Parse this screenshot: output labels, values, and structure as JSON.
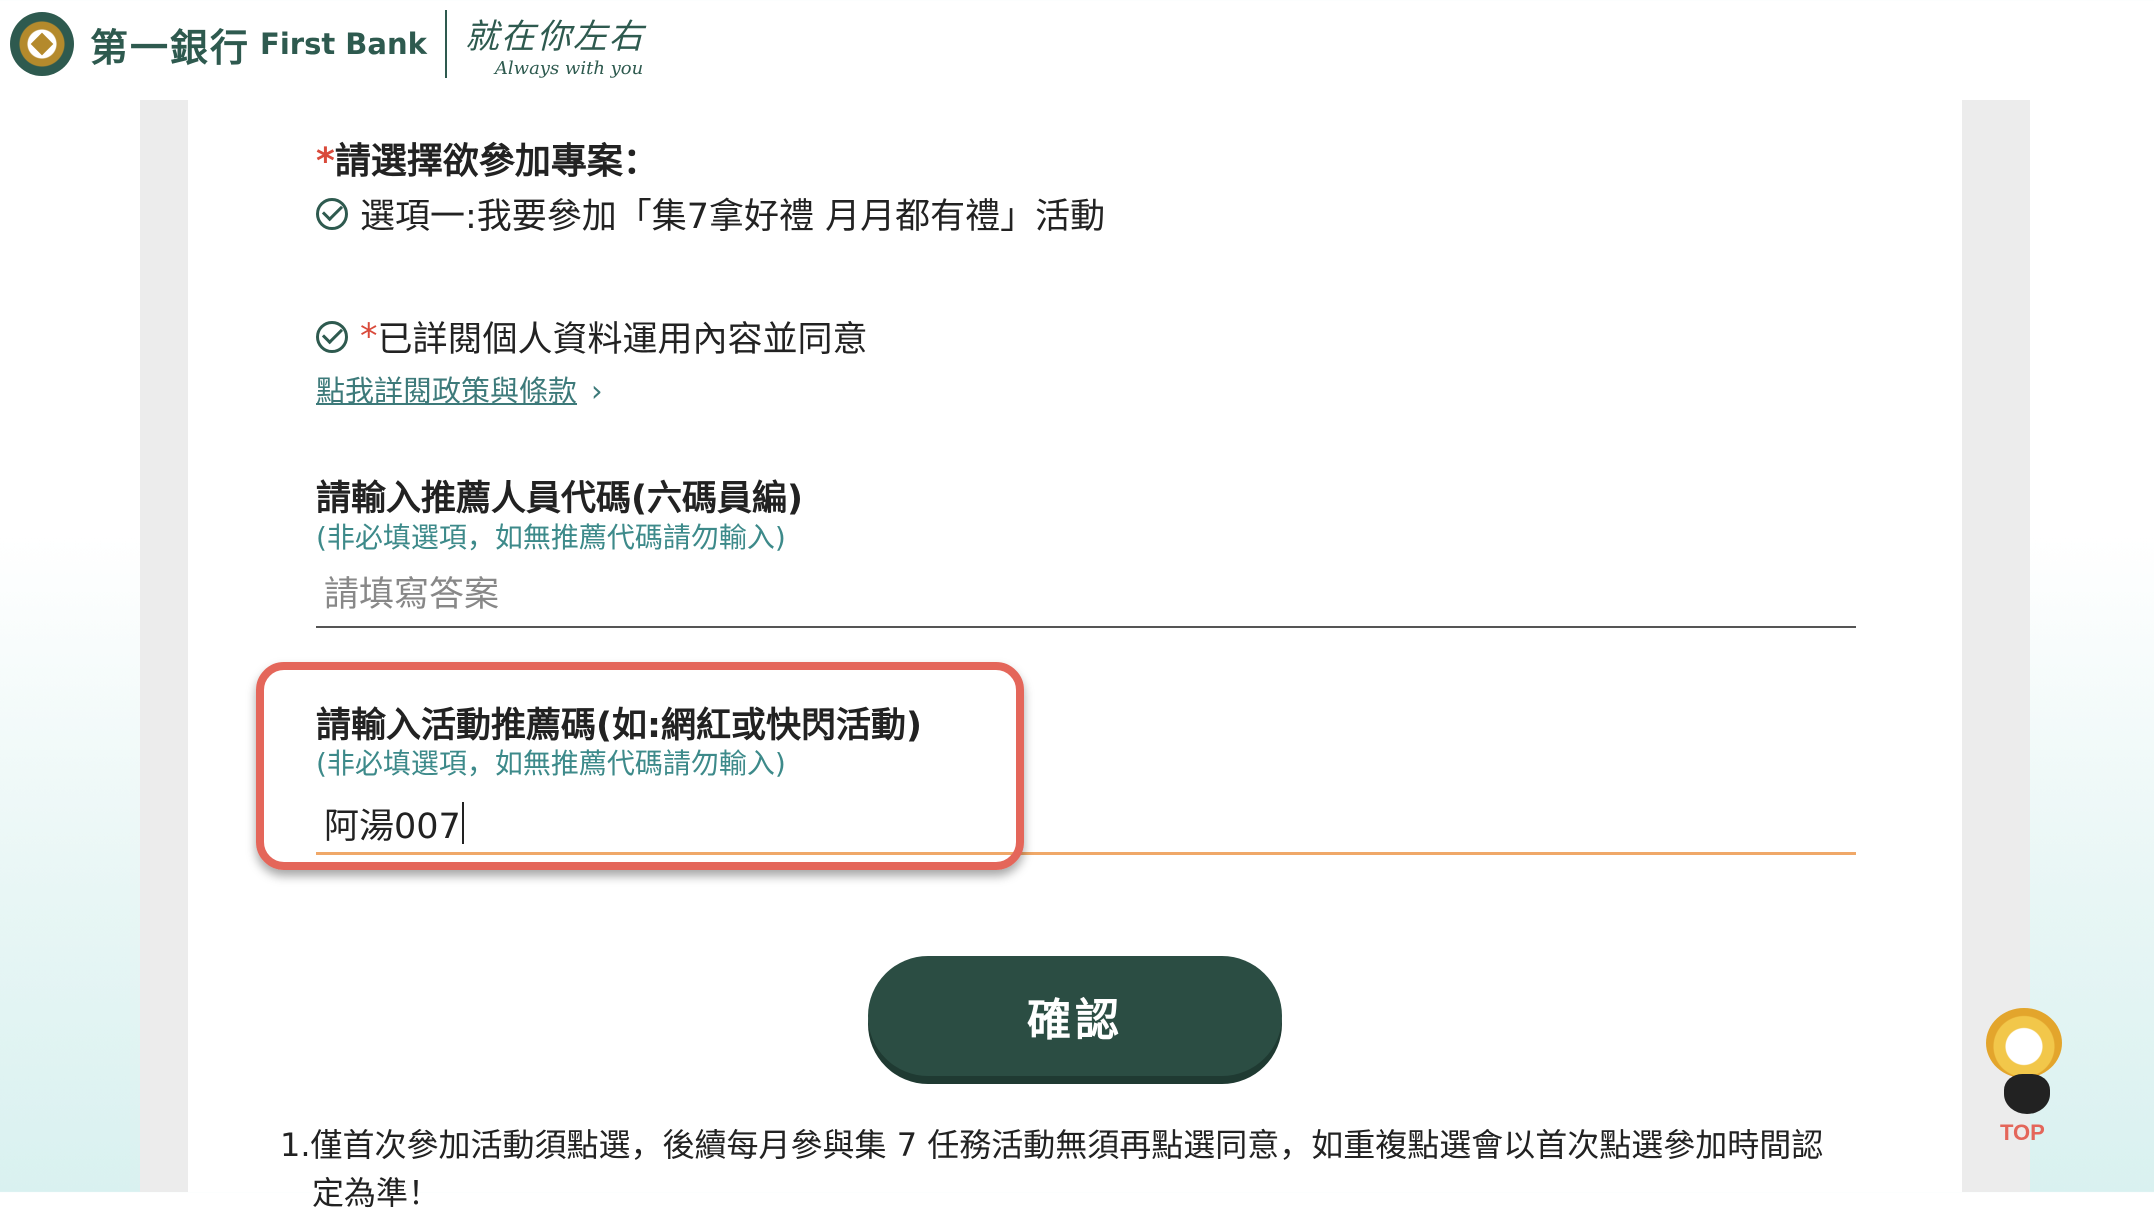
{
  "header": {
    "brand_cn": "第一銀行",
    "brand_en": "First Bank",
    "slogan_cn": "就在你左右",
    "slogan_en": "Always with you"
  },
  "form": {
    "project_question": {
      "required_mark": "*",
      "title": "請選擇欲參加專案：",
      "option_label": "選項一:我要參加「集7拿好禮 月月都有禮」活動",
      "checked": true
    },
    "consent": {
      "required_mark": "*",
      "label": "已詳閱個人資料運用內容並同意",
      "checked": true,
      "policy_link": "點我詳閱政策與條款",
      "policy_chevron": "›"
    },
    "referrer_code": {
      "title": "請輸入推薦人員代碼(六碼員編)",
      "hint": "(非必填選項，如無推薦代碼請勿輸入)",
      "placeholder": "請填寫答案",
      "value": ""
    },
    "campaign_code": {
      "title": "請輸入活動推薦碼(如:網紅或快閃活動)",
      "hint": "(非必填選項，如無推薦代碼請勿輸入)",
      "value": "阿湯007"
    },
    "confirm_label": "確認"
  },
  "notes": {
    "item1_number": "1.",
    "item1_text": "僅首次參加活動須點選，後續每月參與集 7 任務活動無須再點選同意，如重複點選會以首次點選參加時間認",
    "item1_cont": "定為準！"
  },
  "top_widget": {
    "label": "TOP"
  },
  "colors": {
    "brand_green": "#2e5a4f",
    "button_green": "#2b4d43",
    "highlight_red": "#e4665a",
    "required_red": "#d94a3b",
    "hint_teal": "#3d8a8a",
    "active_underline": "#f0a868"
  }
}
